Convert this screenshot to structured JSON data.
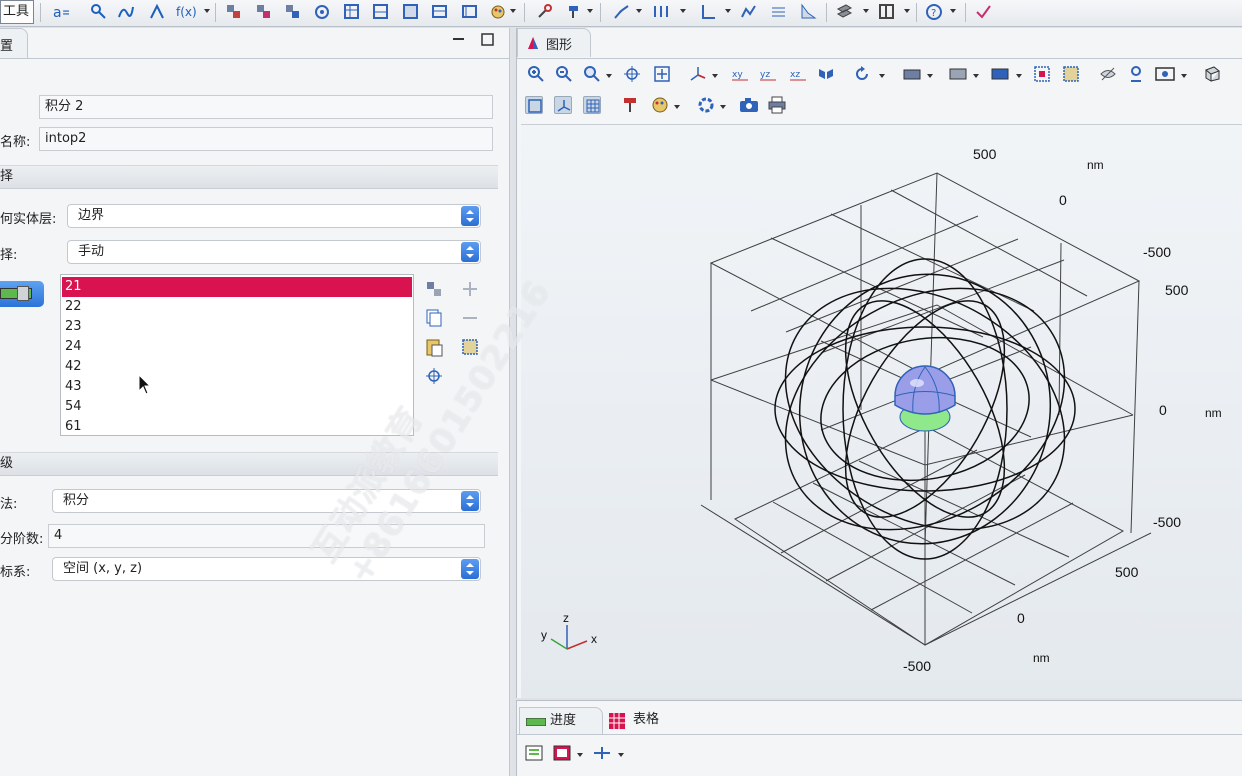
{
  "toolbar": {
    "title": "工具"
  },
  "settings": {
    "tab_label": "置",
    "label_field": {
      "label": "",
      "value": "积分 2"
    },
    "name_field": {
      "label": "名称:",
      "value": "intop2"
    },
    "source_section": {
      "title": "择"
    },
    "geom_level": {
      "label": "何实体层:",
      "value": "边界"
    },
    "selection": {
      "label": "择:",
      "value": "手动"
    },
    "entities": [
      "21",
      "22",
      "23",
      "24",
      "42",
      "43",
      "54",
      "61"
    ],
    "selected_entity": "21",
    "advanced_section": {
      "title": "级"
    },
    "method": {
      "label": "法:",
      "value": "积分"
    },
    "order": {
      "label": "分阶数:",
      "value": "4"
    },
    "frame": {
      "label": "标系:",
      "value": "空间 (x, y, z)"
    }
  },
  "graphics": {
    "tab_label": "图形",
    "axis_ticks": {
      "x_500": "500",
      "x_0": "0",
      "x_m500": "-500",
      "y_500": "500",
      "y_0": "0",
      "y_m500": "-500",
      "z_500": "500",
      "z_0": "0",
      "z_m500": "-500",
      "top_500": "500",
      "top_0": "0",
      "top_m500": "-500",
      "unit_top": "nm",
      "unit_right": "nm",
      "unit_bottom": "nm"
    },
    "triad": {
      "x": "x",
      "y": "y",
      "z": "z"
    }
  },
  "bottom": {
    "tabs": [
      {
        "label": "进度"
      },
      {
        "label": "表格"
      }
    ]
  },
  "watermark": {
    "line1": "互动派教育",
    "line2": "+8616601502216"
  },
  "colors": {
    "accent": "#2b73d8",
    "selected": "#d9134f",
    "sphere": "#9a9ee8",
    "green": "#8fe88a"
  }
}
